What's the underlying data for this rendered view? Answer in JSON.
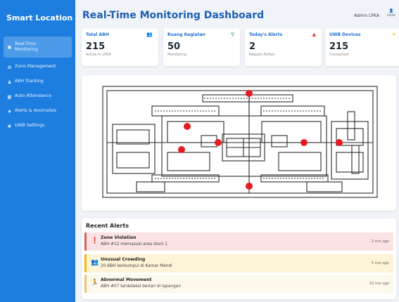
{
  "sidebar": {
    "brand": "Smart Location",
    "items": [
      {
        "label": "Real-Time Monitoring",
        "icon": "dashboard-icon",
        "glyph": "▣"
      },
      {
        "label": "Zone Management",
        "icon": "grid-icon",
        "glyph": "⊞"
      },
      {
        "label": "ABH Tracking",
        "icon": "users-icon",
        "glyph": "♟"
      },
      {
        "label": "Auto Attendance",
        "icon": "calendar-icon",
        "glyph": "▦"
      },
      {
        "label": "Alerts & Anomalies",
        "icon": "bell-icon",
        "glyph": "♦"
      },
      {
        "label": "UWB Settings",
        "icon": "gear-icon",
        "glyph": "✱"
      }
    ]
  },
  "header": {
    "title": "Real-Time Monitoring Dashboard",
    "user": "Admin LPKA",
    "user_icon_label": "User"
  },
  "stats": [
    {
      "title": "Total ABH",
      "value": "215",
      "sub": "Active in LPKA",
      "icon": "users-icon",
      "glyph": "👥",
      "color": "#1e7ee0"
    },
    {
      "title": "Ruang Kegiatan",
      "value": "50",
      "sub": "Monitoring",
      "icon": "map-pin-icon",
      "glyph": "⚲",
      "color": "#22a34a"
    },
    {
      "title": "Today's Alerts",
      "value": "2",
      "sub": "Require Action",
      "icon": "warning-icon",
      "glyph": "▲",
      "color": "#e53935"
    },
    {
      "title": "UWB Devices",
      "value": "215",
      "sub": "Connected",
      "icon": "wifi-icon",
      "glyph": "≋",
      "color": "#f2b705"
    }
  ],
  "map": {
    "marker_color": "#e51c23"
  },
  "alerts": {
    "title": "Recent Alerts",
    "items": [
      {
        "title": "Zone Violation",
        "message": "ABH #12 memasuki area steril 1",
        "time": "2 min ago",
        "icon": "alert-circle-icon",
        "glyph": "❗",
        "bg": "#fbe3e3",
        "border": "#e25b5b",
        "iconColor": "#e53935"
      },
      {
        "title": "Unusual Crowding",
        "message": "20 ABH berkumpul di Kamar Mandi",
        "time": "5 min ago",
        "icon": "group-icon",
        "glyph": "👥",
        "bg": "#fdf3d6",
        "border": "#f2b705",
        "iconColor": "#f2b705"
      },
      {
        "title": "Abnormal Movement",
        "message": "ABH #07 terdeteksi berlari di lapangan",
        "time": "10 min ago",
        "icon": "running-icon",
        "glyph": "🏃",
        "bg": "#fdf8ec",
        "border": "#e8c46a",
        "iconColor": "#1e7ee0"
      }
    ]
  }
}
